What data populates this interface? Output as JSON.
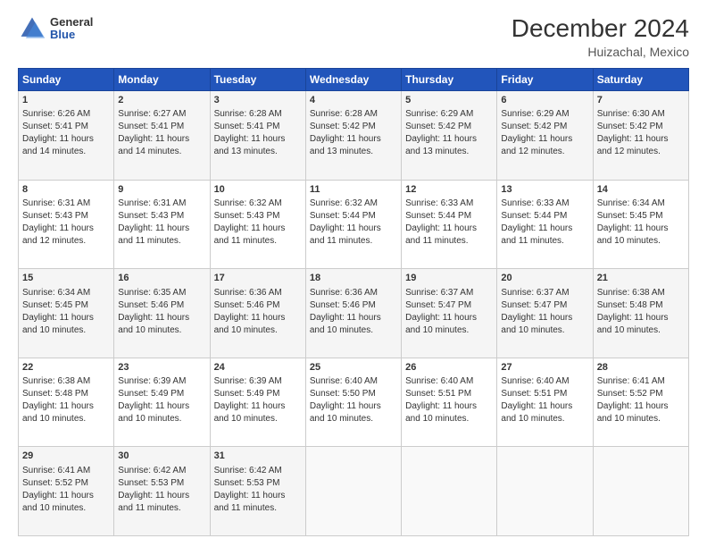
{
  "header": {
    "logo_general": "General",
    "logo_blue": "Blue",
    "month_title": "December 2024",
    "location": "Huizachal, Mexico"
  },
  "days_of_week": [
    "Sunday",
    "Monday",
    "Tuesday",
    "Wednesday",
    "Thursday",
    "Friday",
    "Saturday"
  ],
  "weeks": [
    [
      {
        "day": "1",
        "sunrise": "6:26 AM",
        "sunset": "5:41 PM",
        "daylight": "11 hours and 14 minutes."
      },
      {
        "day": "2",
        "sunrise": "6:27 AM",
        "sunset": "5:41 PM",
        "daylight": "11 hours and 14 minutes."
      },
      {
        "day": "3",
        "sunrise": "6:28 AM",
        "sunset": "5:41 PM",
        "daylight": "11 hours and 13 minutes."
      },
      {
        "day": "4",
        "sunrise": "6:28 AM",
        "sunset": "5:42 PM",
        "daylight": "11 hours and 13 minutes."
      },
      {
        "day": "5",
        "sunrise": "6:29 AM",
        "sunset": "5:42 PM",
        "daylight": "11 hours and 13 minutes."
      },
      {
        "day": "6",
        "sunrise": "6:29 AM",
        "sunset": "5:42 PM",
        "daylight": "11 hours and 12 minutes."
      },
      {
        "day": "7",
        "sunrise": "6:30 AM",
        "sunset": "5:42 PM",
        "daylight": "11 hours and 12 minutes."
      }
    ],
    [
      {
        "day": "8",
        "sunrise": "6:31 AM",
        "sunset": "5:43 PM",
        "daylight": "11 hours and 12 minutes."
      },
      {
        "day": "9",
        "sunrise": "6:31 AM",
        "sunset": "5:43 PM",
        "daylight": "11 hours and 11 minutes."
      },
      {
        "day": "10",
        "sunrise": "6:32 AM",
        "sunset": "5:43 PM",
        "daylight": "11 hours and 11 minutes."
      },
      {
        "day": "11",
        "sunrise": "6:32 AM",
        "sunset": "5:44 PM",
        "daylight": "11 hours and 11 minutes."
      },
      {
        "day": "12",
        "sunrise": "6:33 AM",
        "sunset": "5:44 PM",
        "daylight": "11 hours and 11 minutes."
      },
      {
        "day": "13",
        "sunrise": "6:33 AM",
        "sunset": "5:44 PM",
        "daylight": "11 hours and 11 minutes."
      },
      {
        "day": "14",
        "sunrise": "6:34 AM",
        "sunset": "5:45 PM",
        "daylight": "11 hours and 10 minutes."
      }
    ],
    [
      {
        "day": "15",
        "sunrise": "6:34 AM",
        "sunset": "5:45 PM",
        "daylight": "11 hours and 10 minutes."
      },
      {
        "day": "16",
        "sunrise": "6:35 AM",
        "sunset": "5:46 PM",
        "daylight": "11 hours and 10 minutes."
      },
      {
        "day": "17",
        "sunrise": "6:36 AM",
        "sunset": "5:46 PM",
        "daylight": "11 hours and 10 minutes."
      },
      {
        "day": "18",
        "sunrise": "6:36 AM",
        "sunset": "5:46 PM",
        "daylight": "11 hours and 10 minutes."
      },
      {
        "day": "19",
        "sunrise": "6:37 AM",
        "sunset": "5:47 PM",
        "daylight": "11 hours and 10 minutes."
      },
      {
        "day": "20",
        "sunrise": "6:37 AM",
        "sunset": "5:47 PM",
        "daylight": "11 hours and 10 minutes."
      },
      {
        "day": "21",
        "sunrise": "6:38 AM",
        "sunset": "5:48 PM",
        "daylight": "11 hours and 10 minutes."
      }
    ],
    [
      {
        "day": "22",
        "sunrise": "6:38 AM",
        "sunset": "5:48 PM",
        "daylight": "11 hours and 10 minutes."
      },
      {
        "day": "23",
        "sunrise": "6:39 AM",
        "sunset": "5:49 PM",
        "daylight": "11 hours and 10 minutes."
      },
      {
        "day": "24",
        "sunrise": "6:39 AM",
        "sunset": "5:49 PM",
        "daylight": "11 hours and 10 minutes."
      },
      {
        "day": "25",
        "sunrise": "6:40 AM",
        "sunset": "5:50 PM",
        "daylight": "11 hours and 10 minutes."
      },
      {
        "day": "26",
        "sunrise": "6:40 AM",
        "sunset": "5:51 PM",
        "daylight": "11 hours and 10 minutes."
      },
      {
        "day": "27",
        "sunrise": "6:40 AM",
        "sunset": "5:51 PM",
        "daylight": "11 hours and 10 minutes."
      },
      {
        "day": "28",
        "sunrise": "6:41 AM",
        "sunset": "5:52 PM",
        "daylight": "11 hours and 10 minutes."
      }
    ],
    [
      {
        "day": "29",
        "sunrise": "6:41 AM",
        "sunset": "5:52 PM",
        "daylight": "11 hours and 10 minutes."
      },
      {
        "day": "30",
        "sunrise": "6:42 AM",
        "sunset": "5:53 PM",
        "daylight": "11 hours and 11 minutes."
      },
      {
        "day": "31",
        "sunrise": "6:42 AM",
        "sunset": "5:53 PM",
        "daylight": "11 hours and 11 minutes."
      },
      null,
      null,
      null,
      null
    ]
  ],
  "labels": {
    "sunrise": "Sunrise:",
    "sunset": "Sunset:",
    "daylight": "Daylight:"
  }
}
